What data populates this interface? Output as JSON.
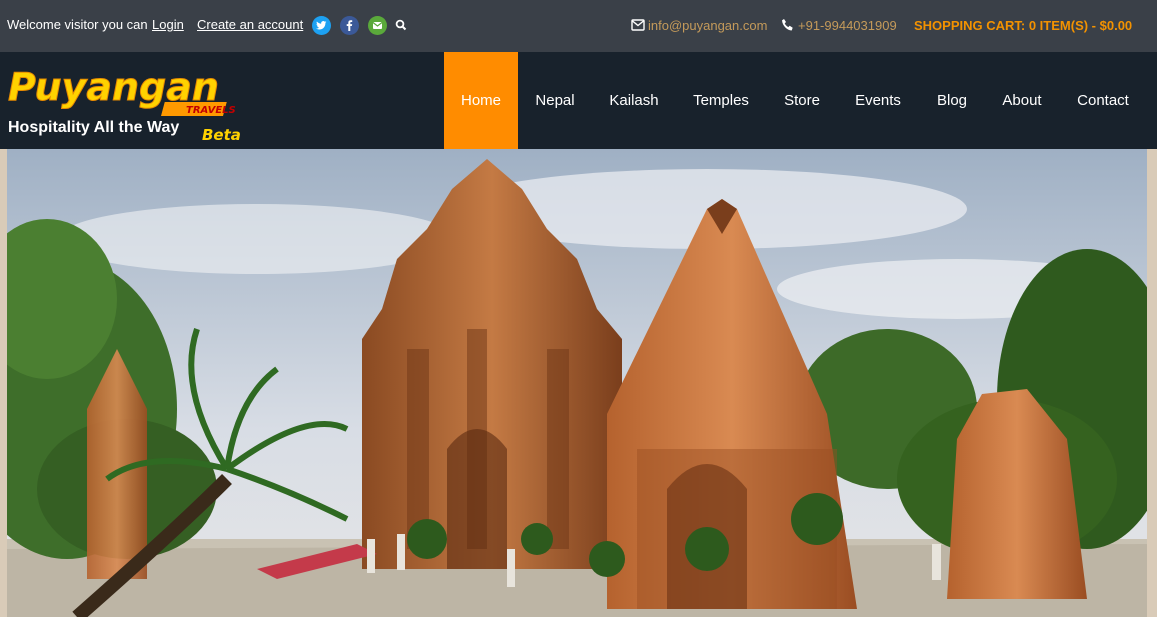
{
  "topbar": {
    "welcome_text": "Welcome visitor you can",
    "login_label": "Login",
    "create_account_label": "Create an account",
    "social": [
      {
        "name": "twitter-icon",
        "glyph": "t",
        "color": "#1da1f2"
      },
      {
        "name": "facebook-icon",
        "glyph": "f",
        "color": "#3b5998"
      },
      {
        "name": "mail-icon",
        "glyph": "✉",
        "color": "#5aa93b"
      }
    ],
    "email": "info@puyangan.com",
    "phone": "+91-9944031909",
    "cart": "SHOPPING CART: 0 ITEM(S) - $0.00"
  },
  "logo": {
    "brand": "Puyangan",
    "travels": "TRAVELS",
    "tagline": "Hospitality All the Way",
    "beta": "Beta"
  },
  "nav": [
    {
      "label": "Home",
      "active": true
    },
    {
      "label": "Nepal"
    },
    {
      "label": "Kailash"
    },
    {
      "label": "Temples"
    },
    {
      "label": "Store"
    },
    {
      "label": "Events"
    },
    {
      "label": "Blog"
    },
    {
      "label": "About"
    },
    {
      "label": "Contact"
    }
  ],
  "colors": {
    "accent": "#ff8c00",
    "topbar_bg": "#3a4048",
    "header_bg": "#18222c",
    "cart_color": "#f39200"
  }
}
